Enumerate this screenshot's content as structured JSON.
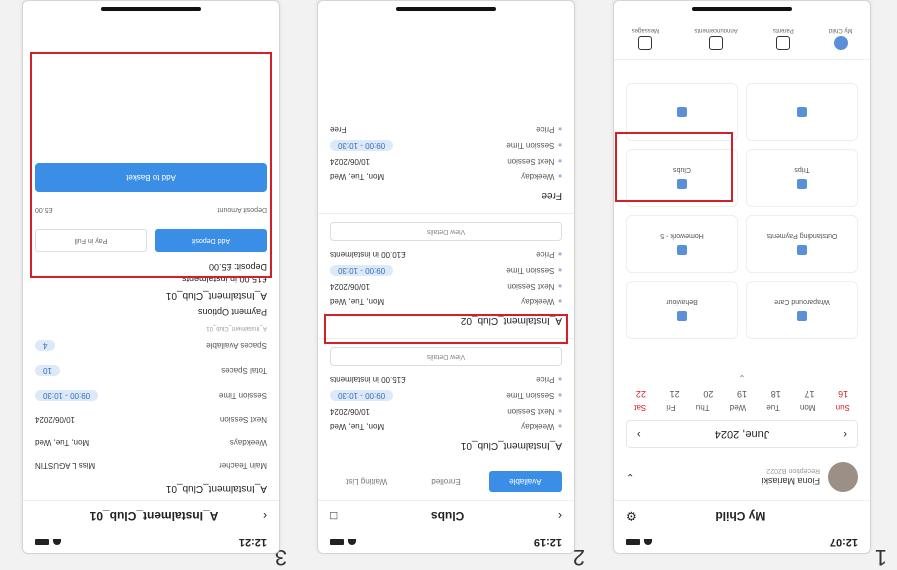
{
  "step_numbers": [
    "1",
    "2",
    "3"
  ],
  "phone1": {
    "status_time": "12:07",
    "title": "My Child",
    "profile_name": "Fiona Mariaski",
    "profile_sub": "Reception B2022",
    "month": "June, 2024",
    "weekdays": [
      "Sun",
      "Mon",
      "Tue",
      "Wed",
      "Thu",
      "Fri",
      "Sat"
    ],
    "dates": [
      "16",
      "17",
      "18",
      "19",
      "20",
      "21",
      "22"
    ],
    "tiles": [
      "Wraparound Care",
      "Behaviour",
      "Outstanding Payments",
      "Homework - 5",
      "Trips",
      "Clubs",
      "",
      ""
    ],
    "nav": [
      "My Child",
      "Parents",
      "Announcements",
      "Messages"
    ]
  },
  "phone2": {
    "status_time": "12:19",
    "title": "Clubs",
    "tabs": [
      "Available",
      "Enrolled",
      "Waiting List"
    ],
    "cards": [
      {
        "title": "A_Instalment_Club_01",
        "weekday": "Mon, Tue, Wed",
        "next_session": "10/06/2024",
        "session_time": "09:00 - 10:30",
        "price": "£15.00 in instalments",
        "view": "View Details"
      },
      {
        "title": "A_Instalment_Club_02",
        "weekday": "Mon, Tue, Wed",
        "next_session": "10/06/2024",
        "session_time": "09:00 - 10:30",
        "price": "£10.00 in instalments",
        "view": "View Details"
      },
      {
        "title": "Free",
        "weekday": "Mon, Tue, Wed",
        "next_session": "10/06/2024",
        "session_time": "09:00 - 10:30",
        "price": "Free",
        "view": ""
      }
    ],
    "labels": {
      "weekday": "Weekday",
      "next_session": "Next Session",
      "session_time": "Session Time",
      "price": "Price"
    }
  },
  "phone3": {
    "status_time": "12:21",
    "title": "A_Instalment_Club_01",
    "heading": "A_Instalment_Club_01",
    "rows": [
      {
        "label": "Main Teacher",
        "value": "Miss L AGUSTIN"
      },
      {
        "label": "Weekdays",
        "value": "Mon, Tue, Wed"
      },
      {
        "label": "Next Session",
        "value": "10/06/2024"
      },
      {
        "label": "Session Time",
        "value": "09:00 - 10:30"
      },
      {
        "label": "Total Spaces",
        "value": "10"
      },
      {
        "label": "Spaces Available",
        "value": "4"
      }
    ],
    "crumb": "A_Instalment_Club_01",
    "payment_title": "Payment Options",
    "club_name": "A_Instalment_Club_01",
    "instalments": "£15.00 in instalments",
    "deposit": "Deposit: £5.00",
    "btn_deposit": "Add Deposit",
    "btn_full": "Pay in Full",
    "deposit_label": "Deposit Amount",
    "deposit_value": "£5.00",
    "basket": "Add to Basket"
  }
}
